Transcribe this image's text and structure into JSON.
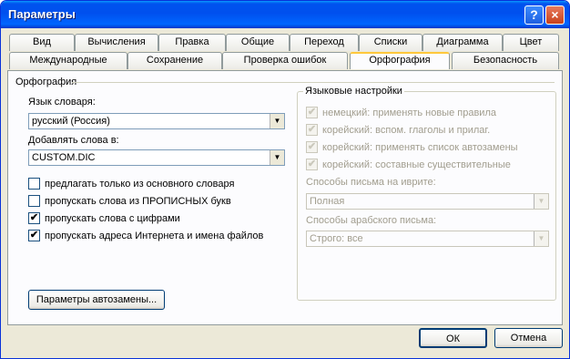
{
  "window": {
    "title": "Параметры",
    "help_glyph": "?",
    "close_glyph": "×"
  },
  "tabs_row1": [
    "Вид",
    "Вычисления",
    "Правка",
    "Общие",
    "Переход",
    "Списки",
    "Диаграмма",
    "Цвет"
  ],
  "tabs_row2": [
    "Международные",
    "Сохранение",
    "Проверка ошибок",
    "Орфография",
    "Безопасность"
  ],
  "active_tab": "Орфография",
  "section": {
    "title": "Орфография",
    "dictionary_language_label": "Язык словаря:",
    "dictionary_language_value": "русский (Россия)",
    "add_words_label": "Добавлять слова в:",
    "add_words_value": "CUSTOM.DIC",
    "checkboxes": [
      {
        "label": "предлагать только из основного словаря",
        "checked": false
      },
      {
        "label": "пропускать слова из ПРОПИСНЫХ букв",
        "checked": false
      },
      {
        "label": "пропускать слова с цифрами",
        "checked": true
      },
      {
        "label": "пропускать адреса Интернета и имена файлов",
        "checked": true
      }
    ],
    "autocorrect_button": "Параметры автозамены..."
  },
  "language_settings": {
    "title": "Языковые настройки",
    "checkboxes": [
      {
        "label": "немецкий: применять новые правила",
        "checked": true
      },
      {
        "label": "корейский: вспом. глаголы и прилаг.",
        "checked": true
      },
      {
        "label": "корейский: применять список автозамены",
        "checked": true
      },
      {
        "label": "корейский: составные существительные",
        "checked": true
      }
    ],
    "hebrew_label": "Способы письма на иврите:",
    "hebrew_value": "Полная",
    "arabic_label": "Способы арабского письма:",
    "arabic_value": "Строго: все"
  },
  "footer": {
    "ok": "ОК",
    "cancel": "Отмена"
  },
  "check_glyph": "✔"
}
